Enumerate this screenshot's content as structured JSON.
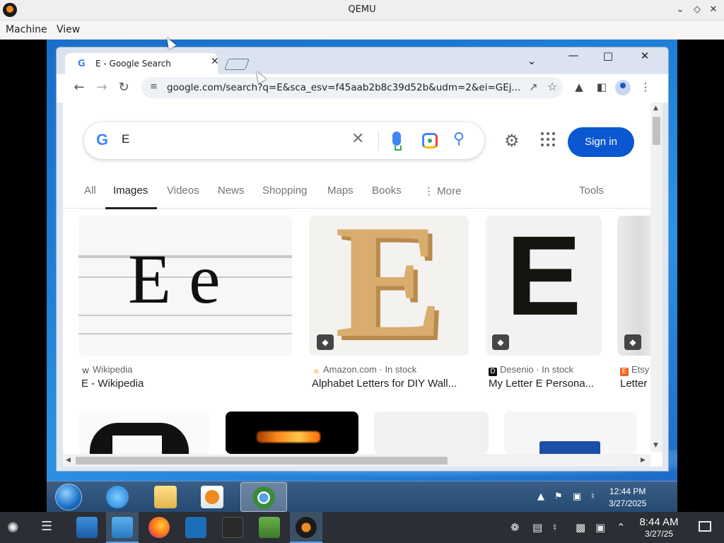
{
  "qemu": {
    "title": "QEMU",
    "menu": [
      "Machine",
      "View"
    ]
  },
  "chrome": {
    "tab_title": "E - Google Search",
    "url": "google.com/search?q=E&sca_esv=f45aab2b8c39d52b&udm=2&ei=GEj..."
  },
  "search": {
    "query": "E",
    "sign_in": "Sign in",
    "tabs": [
      "All",
      "Images",
      "Videos",
      "News",
      "Shopping",
      "Maps",
      "Books",
      "More",
      "Tools"
    ],
    "active_tab": "Images"
  },
  "results": [
    {
      "source": "Wikipedia",
      "title": "E - Wikipedia",
      "image_text": "E e"
    },
    {
      "source": "Amazon.com",
      "stock": "In stock",
      "title": "Alphabet Letters for DIY Wall...",
      "image_text": "E"
    },
    {
      "source": "Desenio",
      "stock": "In stock",
      "title": "My Letter E Persona...",
      "image_text": "E"
    },
    {
      "source": "Etsy",
      "title": "Letter"
    }
  ],
  "guest_taskbar": {
    "time": "12:44 PM",
    "date": "3/27/2025"
  },
  "host_taskbar": {
    "time": "8:44 AM",
    "date": "3/27/25"
  },
  "colors": {
    "google_blue": "#4285f4",
    "sign_in_bg": "#0b57d0",
    "guest_desktop": "#1e80d8"
  }
}
